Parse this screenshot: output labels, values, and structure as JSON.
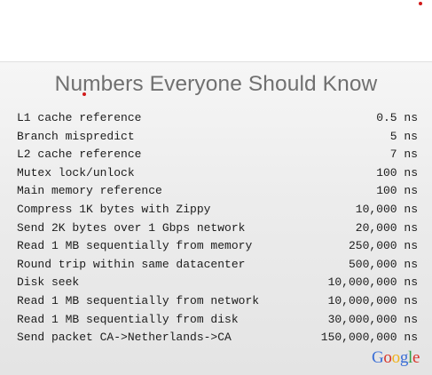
{
  "slide": {
    "title": "Numbers Everyone Should Know",
    "rows": [
      {
        "operation": "L1 cache reference",
        "latency": "0.5 ns"
      },
      {
        "operation": "Branch mispredict",
        "latency": "5 ns"
      },
      {
        "operation": "L2 cache reference",
        "latency": "7 ns"
      },
      {
        "operation": "Mutex lock/unlock",
        "latency": "100 ns"
      },
      {
        "operation": "Main memory reference",
        "latency": "100 ns"
      },
      {
        "operation": "Compress 1K bytes with Zippy",
        "latency": "10,000 ns"
      },
      {
        "operation": "Send 2K bytes over 1 Gbps network",
        "latency": "20,000 ns"
      },
      {
        "operation": "Read 1 MB sequentially from memory",
        "latency": "250,000 ns"
      },
      {
        "operation": "Round trip within same datacenter",
        "latency": "500,000 ns"
      },
      {
        "operation": "Disk seek",
        "latency": "10,000,000 ns"
      },
      {
        "operation": "Read 1 MB sequentially from network",
        "latency": "10,000,000 ns"
      },
      {
        "operation": "Read 1 MB sequentially from disk",
        "latency": "30,000,000 ns"
      },
      {
        "operation": "Send packet CA->Netherlands->CA",
        "latency": "150,000,000 ns"
      }
    ],
    "logo": {
      "text": "Google",
      "letter_colors": [
        "#3b6fd6",
        "#d8332a",
        "#f0b21b",
        "#3b6fd6",
        "#2f9e44",
        "#d8332a"
      ]
    }
  }
}
